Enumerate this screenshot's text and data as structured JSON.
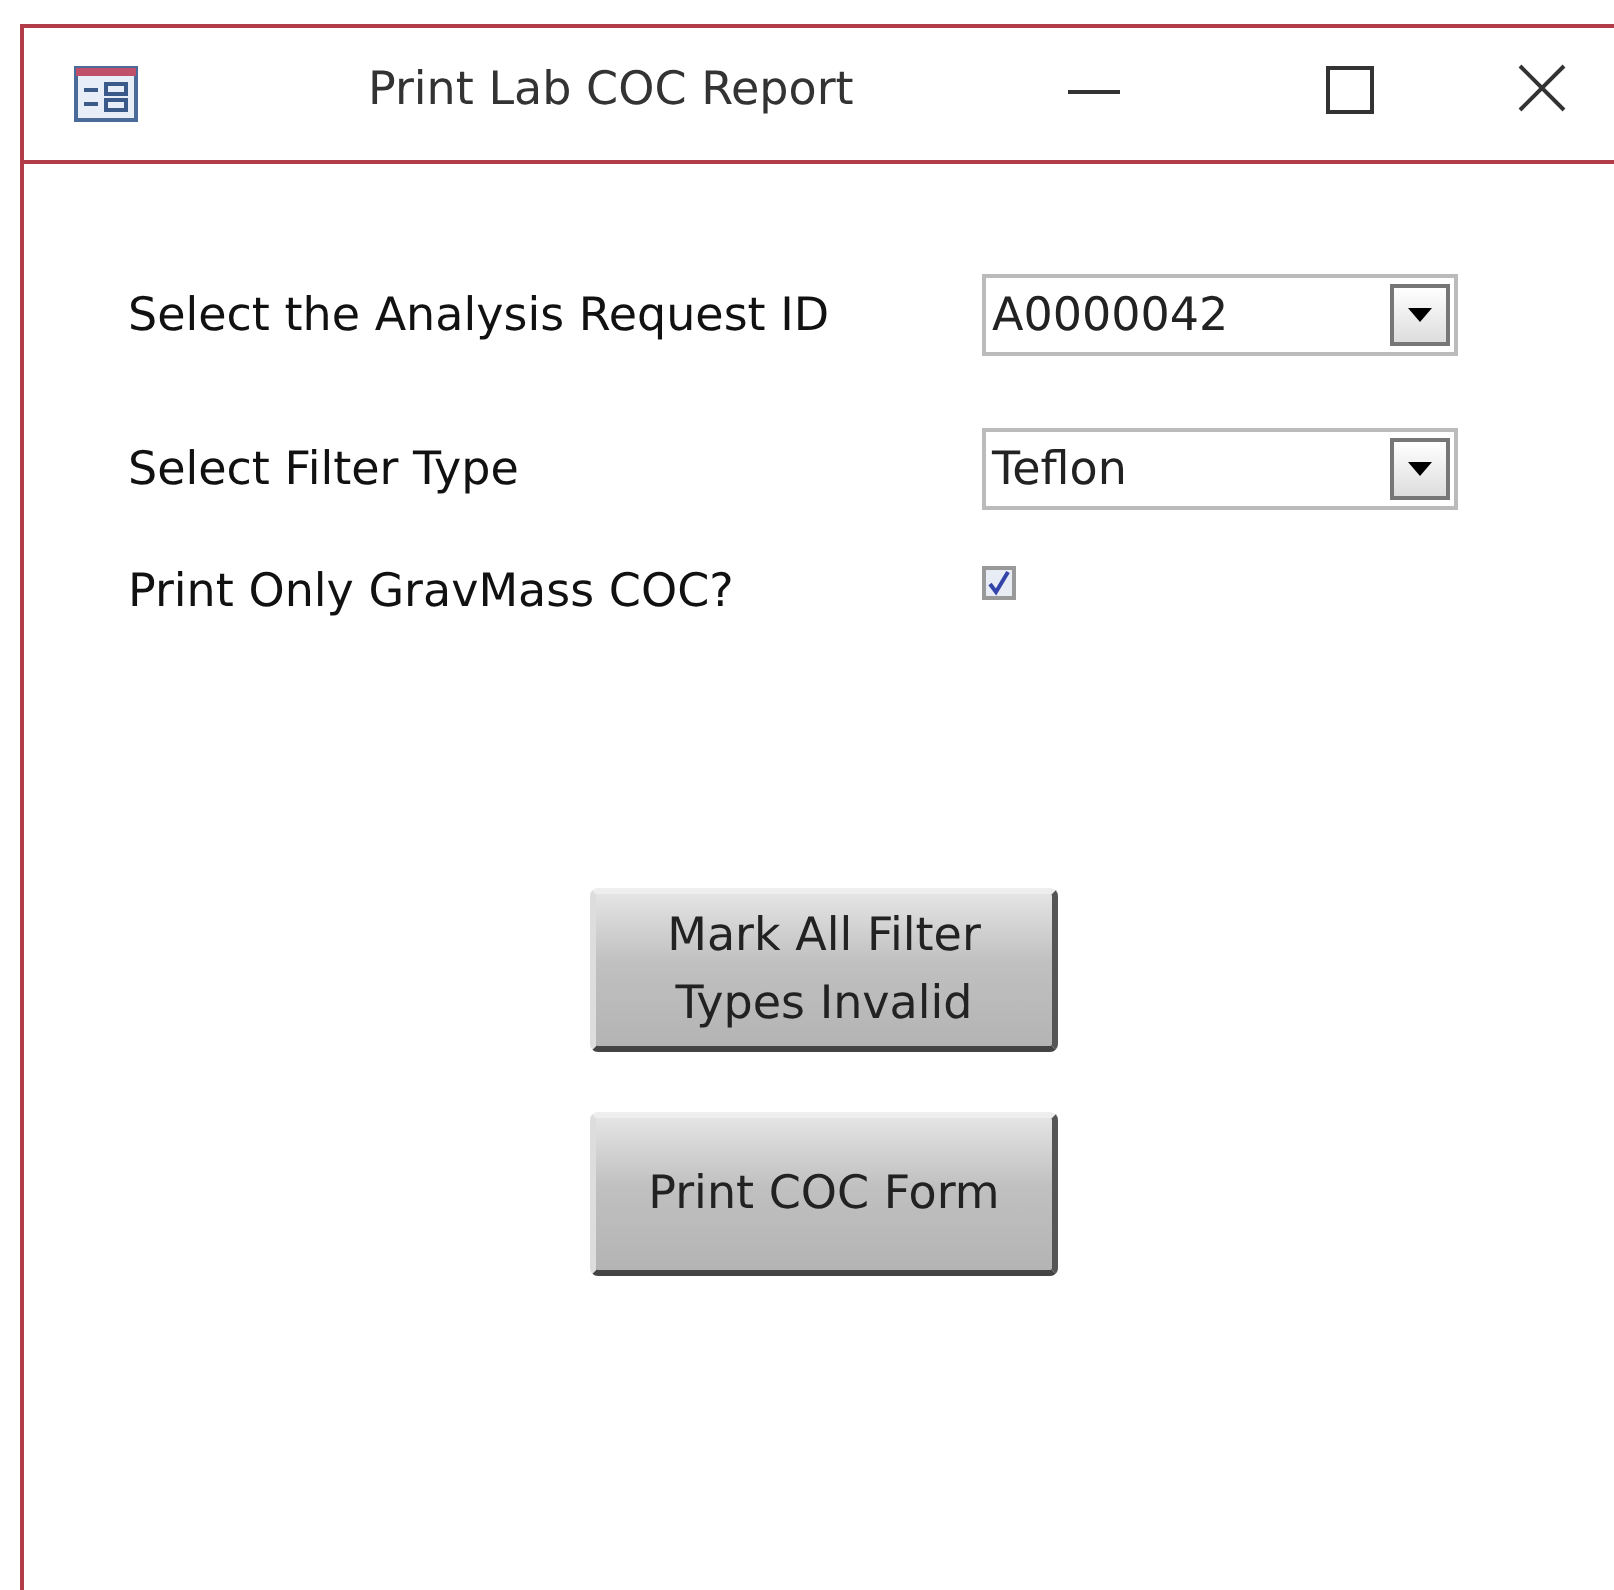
{
  "window": {
    "title": "Print Lab COC Report"
  },
  "fields": [
    {
      "kind": "combo",
      "label": "Select the Analysis Request ID",
      "value": "A0000042"
    },
    {
      "kind": "combo",
      "label": "Select Filter Type",
      "value": "Teflon"
    },
    {
      "kind": "checkbox",
      "label": "Print Only GravMass COC?",
      "checked": true
    }
  ],
  "buttons": [
    "Mark All Filter Types Invalid",
    "Print COC Form"
  ]
}
